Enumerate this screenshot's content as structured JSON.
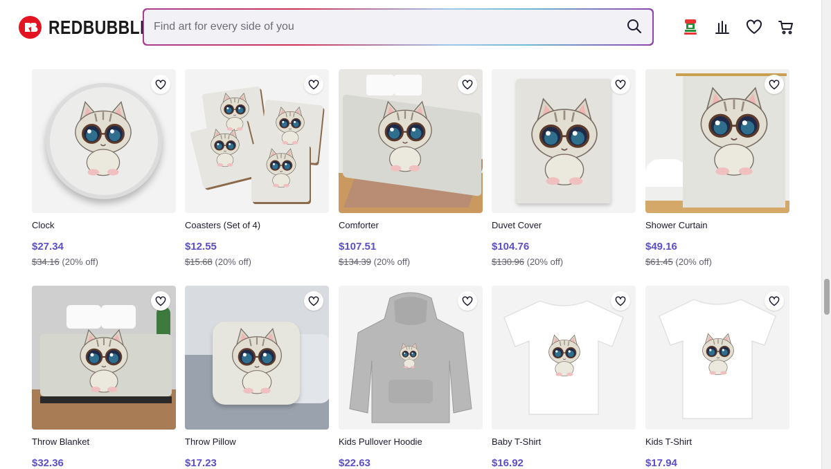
{
  "brand": {
    "name": "REDBUBBLE",
    "logo_mark": "RB"
  },
  "search": {
    "placeholder": "Find art for every side of you"
  },
  "header_icons": [
    "user-avatar-icon",
    "activity-icon",
    "heart-icon",
    "cart-icon"
  ],
  "accent_price_color": "#5b4fc7",
  "products": [
    {
      "title": "Clock",
      "price": "$27.34",
      "original_price": "$34.16",
      "discount": "(20% off)",
      "art": "clock"
    },
    {
      "title": "Coasters (Set of 4)",
      "price": "$12.55",
      "original_price": "$15.68",
      "discount": "(20% off)",
      "art": "coasters"
    },
    {
      "title": "Comforter",
      "price": "$107.51",
      "original_price": "$134.39",
      "discount": "(20% off)",
      "art": "comforter"
    },
    {
      "title": "Duvet Cover",
      "price": "$104.76",
      "original_price": "$130.96",
      "discount": "(20% off)",
      "art": "duvet"
    },
    {
      "title": "Shower Curtain",
      "price": "$49.16",
      "original_price": "$61.45",
      "discount": "(20% off)",
      "art": "curtain"
    },
    {
      "title": "Throw Blanket",
      "price": "$32.36",
      "original_price": "",
      "discount": "",
      "art": "blanket"
    },
    {
      "title": "Throw Pillow",
      "price": "$17.23",
      "original_price": "",
      "discount": "",
      "art": "pillow"
    },
    {
      "title": "Kids Pullover Hoodie",
      "price": "$22.63",
      "original_price": "",
      "discount": "",
      "art": "hoodie"
    },
    {
      "title": "Baby T-Shirt",
      "price": "$16.92",
      "original_price": "",
      "discount": "",
      "art": "babytee"
    },
    {
      "title": "Kids T-Shirt",
      "price": "$17.94",
      "original_price": "",
      "discount": "",
      "art": "kidstee"
    }
  ]
}
